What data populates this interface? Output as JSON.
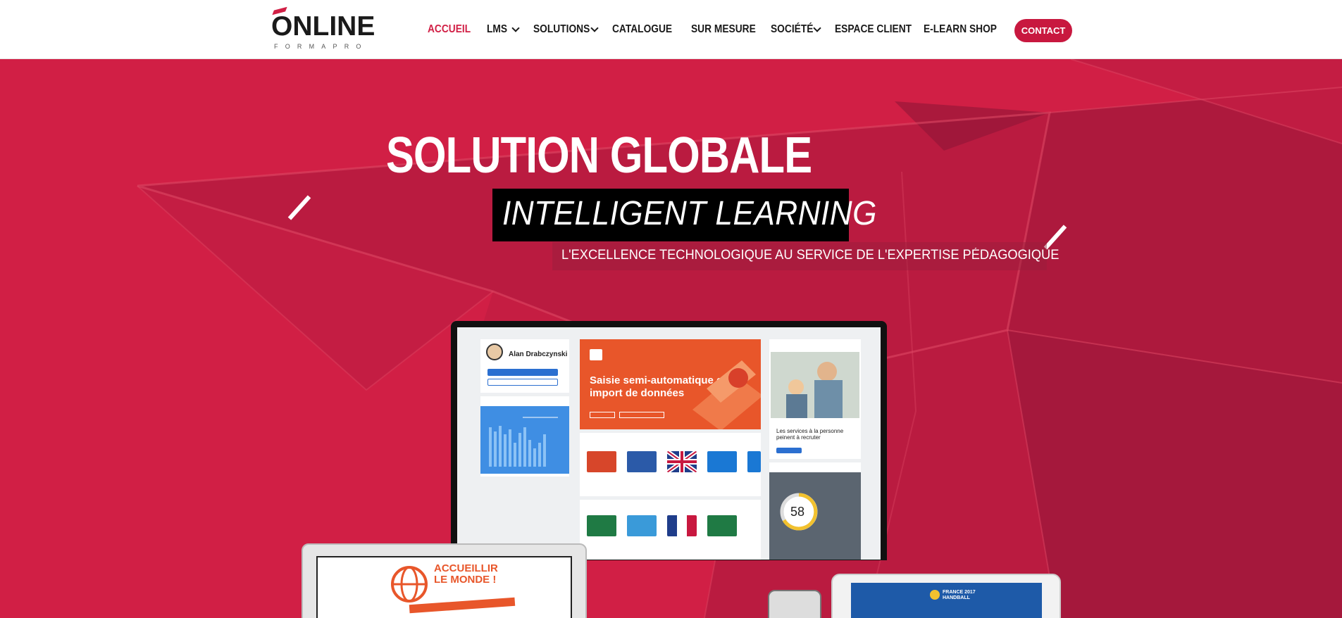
{
  "header": {
    "logo": {
      "word": "ONLINE",
      "subtitle": "FORMAPRO"
    },
    "nav": [
      {
        "label": "ACCUEIL",
        "active": true,
        "has_dropdown": false
      },
      {
        "label": "LMS",
        "active": false,
        "has_dropdown": true
      },
      {
        "label": "SOLUTIONS",
        "active": false,
        "has_dropdown": true
      },
      {
        "label": "CATALOGUE",
        "active": false,
        "has_dropdown": false
      },
      {
        "label": "SUR MESURE",
        "active": false,
        "has_dropdown": false
      },
      {
        "label": "SOCIÉTÉ",
        "active": false,
        "has_dropdown": true
      },
      {
        "label": "ESPACE CLIENT",
        "active": false,
        "has_dropdown": false
      },
      {
        "label": "E-LEARN SHOP",
        "active": false,
        "has_dropdown": false
      }
    ],
    "contact_label": "CONTACT"
  },
  "hero": {
    "title": "SOLUTION GLOBALE",
    "subtitle": "INTELLIGENT LEARNING",
    "tagline": "L'EXCELLENCE TECHNOLOGIQUE AU SERVICE DE L'EXPERTISE PÉDAGOGIQUE"
  },
  "mockup": {
    "profile_name": "Alan Drabczynski",
    "promo_title": "Saisie semi-automatique et import de données",
    "news_title": "Les services à la personne peinent à recruter",
    "ring_value": "58",
    "laptop_headline": "ACCUEILLIR LE MONDE !",
    "tablet_label": "FRANCE 2017 HANDBALL"
  },
  "colors": {
    "brand": "#d11f45",
    "contact": "#c8183f",
    "text": "#1a1a1a"
  }
}
